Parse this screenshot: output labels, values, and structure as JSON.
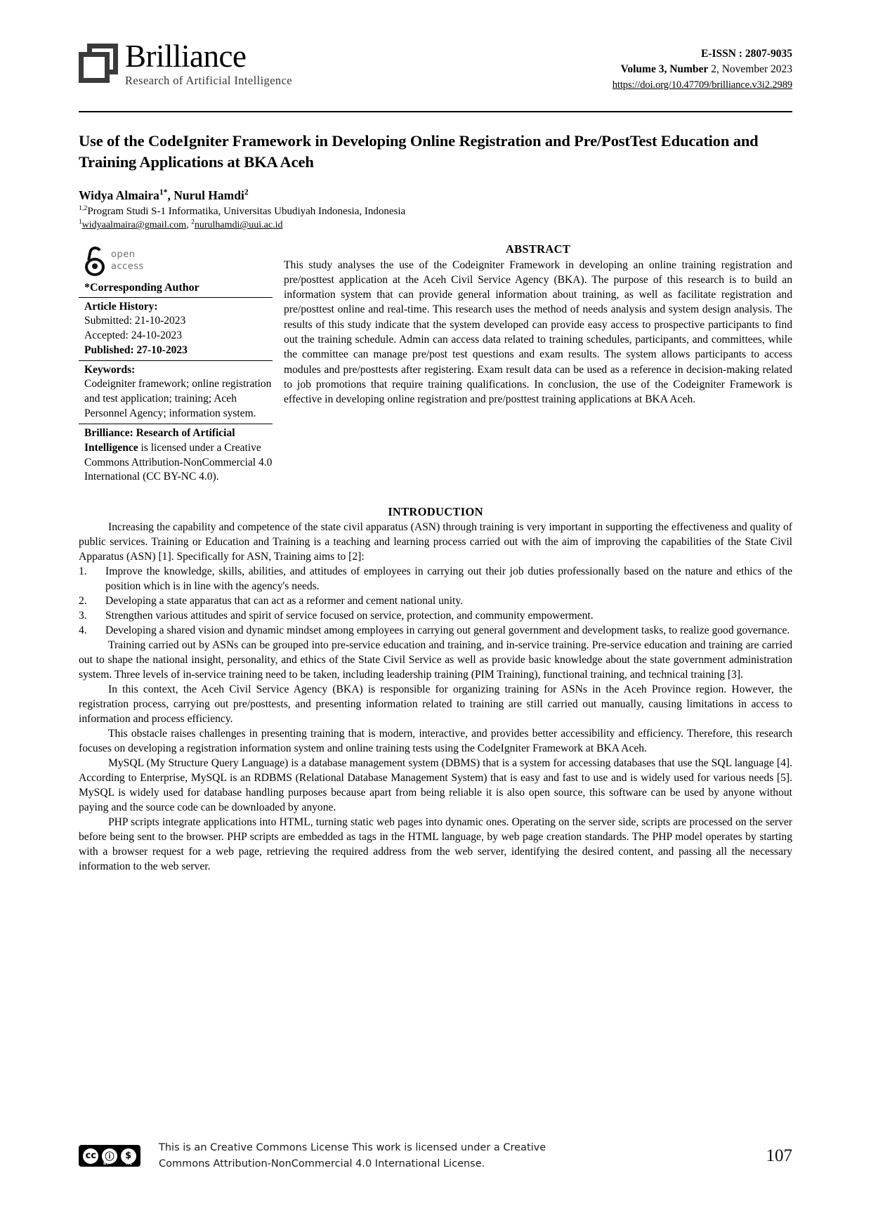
{
  "journal": {
    "logo_title": "Brilliance",
    "logo_subtitle": "Research of Artificial Intelligence",
    "eissn": "E-ISSN : 2807-9035",
    "volume_line": "Volume 3, Number 2, November 2023",
    "volume_bold": "Volume 3, Number",
    "volume_rest": " 2, November 2023",
    "doi": "https://doi.org/10.47709/brilliance.v3i2.2989"
  },
  "article": {
    "title": "Use of the CodeIgniter Framework in Developing Online Registration and Pre/PostTest Education and Training Applications at BKA Aceh",
    "authors": "Widya Almaira1*, Nurul Hamdi2",
    "author_one": "Widya Almaira",
    "author_one_sup": "1*",
    "author_two": "Nurul Hamdi",
    "author_two_sup": "2",
    "affiliation_sup": "1,2",
    "affiliation": "Program Studi S-1 Informatika, Universitas Ubudiyah Indonesia, Indonesia",
    "email_one_sup": "1",
    "email_one": "widyaalmaira@gmail.com",
    "email_two_sup": "2",
    "email_two": "nurulhamdi@uui.ac.id"
  },
  "sidebar": {
    "open_access_line1": "open",
    "open_access_line2": "access",
    "corresponding_author": "*Corresponding Author",
    "article_history_label": "Article History:",
    "submitted": "Submitted: 21-10-2023",
    "accepted": "Accepted: 24-10-2023",
    "published": "Published: 27-10-2023",
    "keywords_label": "Keywords:",
    "keywords": "Codeigniter framework; online registration and test application; training; Aceh Personnel Agency; information system.",
    "license_bold": "Brilliance: Research of Artificial Intelligence",
    "license_rest": " is licensed under a Creative Commons Attribution-NonCommercial 4.0 International (CC BY-NC 4.0)."
  },
  "abstract": {
    "heading": "ABSTRACT",
    "text": "This study analyses the use of the Codeigniter Framework in developing an online training registration and pre/posttest application at the Aceh Civil Service Agency (BKA). The purpose of this research is to build an information system that can provide general information about training, as well as facilitate registration and pre/posttest online and real-time. This research uses the method of needs analysis and system design analysis. The results of this study indicate that the system developed can provide easy access to prospective participants to find out the training schedule. Admin can access data related to training schedules, participants, and committees, while the committee can manage pre/post test questions and exam results. The system allows participants to access modules and pre/posttests after registering. Exam result data can be used as a reference in decision-making related to job promotions that require training qualifications. In conclusion, the use of the Codeigniter Framework is effective in developing online registration and pre/posttest training applications at BKA Aceh."
  },
  "introduction": {
    "heading": "INTRODUCTION",
    "para1": "Increasing the capability and competence of the state civil apparatus (ASN) through training is very important in supporting the effectiveness and quality of public services. Training or Education and Training is a teaching and learning process carried out with the aim of improving the capabilities of the State Civil Apparatus (ASN) [1]. Specifically for ASN, Training aims to [2]:",
    "aims": [
      {
        "num": "1.",
        "text": "Improve the knowledge, skills, abilities, and attitudes of employees in carrying out their job duties professionally based on the nature and ethics of the position which is in line with the agency's needs."
      },
      {
        "num": "2.",
        "text": "Developing a state apparatus that can act as a reformer and cement national unity."
      },
      {
        "num": "3.",
        "text": "Strengthen various attitudes and spirit of service focused on service, protection, and community empowerment."
      },
      {
        "num": "4.",
        "text": "Developing a shared vision and dynamic mindset among employees in carrying out general government and development tasks, to realize good governance."
      }
    ],
    "para2": "Training carried out by ASNs can be grouped into pre-service education and training, and in-service training. Pre-service education and training are carried out to shape the national insight, personality, and ethics of the State Civil Service as well as provide basic knowledge about the state government administration system. Three levels of in-service training need to be taken, including leadership training (PIM Training), functional training, and technical training [3].",
    "para3": "In this context, the Aceh Civil Service Agency (BKA) is responsible for organizing training for ASNs in the Aceh Province region. However, the registration process, carrying out pre/posttests, and presenting information related to training are still carried out manually, causing limitations in access to information and process efficiency.",
    "para4": "This obstacle raises challenges in presenting training that is modern, interactive, and provides better accessibility and efficiency. Therefore, this research focuses on developing a registration information system and online training tests using the CodeIgniter Framework at BKA Aceh.",
    "para5": "MySQL (My Structure Query Language) is a database management system (DBMS) that is a system for accessing databases that use the SQL language [4]. According to Enterprise, MySQL is an RDBMS (Relational Database Management System) that is easy and fast to use and is widely used for various needs [5]. MySQL is widely used for database handling purposes because apart from being reliable it is also open source, this software can be used by anyone without paying and the source code can be downloaded by anyone.",
    "para6": "PHP scripts integrate applications into HTML, turning static web pages into dynamic ones. Operating on the server side, scripts are processed on the server before being sent to the browser. PHP scripts are embedded as tags in the HTML language, by web page creation standards. The PHP model operates by starting with a browser request for a web page, retrieving the required address from the web server, identifying the desired content, and passing all the necessary information to the web server."
  },
  "footer": {
    "license_line1": "This is an Creative Commons License This work is licensed under a Creative",
    "license_line2": "Commons Attribution-NonCommercial 4.0 International License.",
    "cc_glyph": "cc",
    "by_glyph": "ⓘ",
    "nc_glyph": "$",
    "by_label": "BY",
    "nc_label": "NC",
    "page_number": "107"
  }
}
